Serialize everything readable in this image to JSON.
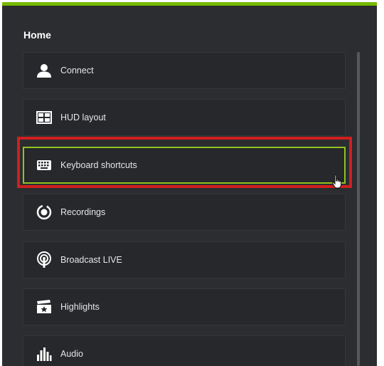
{
  "panel": {
    "title": "Home",
    "accent_color": "#76b900",
    "highlight_color": "#d01f1f",
    "active_border_color": "#8fc31f"
  },
  "menu": {
    "items": [
      {
        "label": "Connect",
        "icon": "person-icon"
      },
      {
        "label": "HUD layout",
        "icon": "layout-icon"
      },
      {
        "label": "Keyboard shortcuts",
        "icon": "keyboard-icon",
        "active": true
      },
      {
        "label": "Recordings",
        "icon": "record-icon"
      },
      {
        "label": "Broadcast LIVE",
        "icon": "broadcast-icon"
      },
      {
        "label": "Highlights",
        "icon": "clapperboard-icon"
      },
      {
        "label": "Audio",
        "icon": "audio-bars-icon"
      }
    ]
  }
}
